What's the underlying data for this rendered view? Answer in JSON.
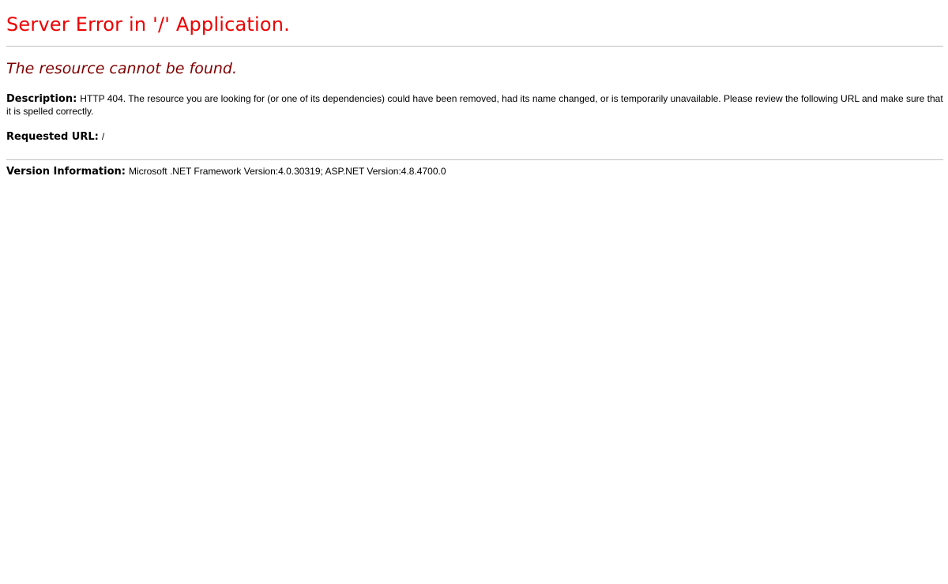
{
  "page": {
    "title": "Server Error in '/' Application.",
    "subtitle": "The resource cannot be found.",
    "description": {
      "label": "Description:",
      "text": "HTTP 404. The resource you are looking for (or one of its dependencies) could have been removed, had its name changed, or is temporarily unavailable.  Please review the following URL and make sure that it is spelled correctly."
    },
    "requested_url": {
      "label": "Requested URL:",
      "value": "/"
    },
    "version_info": {
      "label": "Version Information:",
      "value": "Microsoft .NET Framework Version:4.0.30319; ASP.NET Version:4.8.4700.0"
    }
  },
  "colors": {
    "title": "#ee0000",
    "subtitle": "#800000",
    "rule": "#c0c0c0",
    "text": "#000000",
    "background": "#ffffff"
  }
}
